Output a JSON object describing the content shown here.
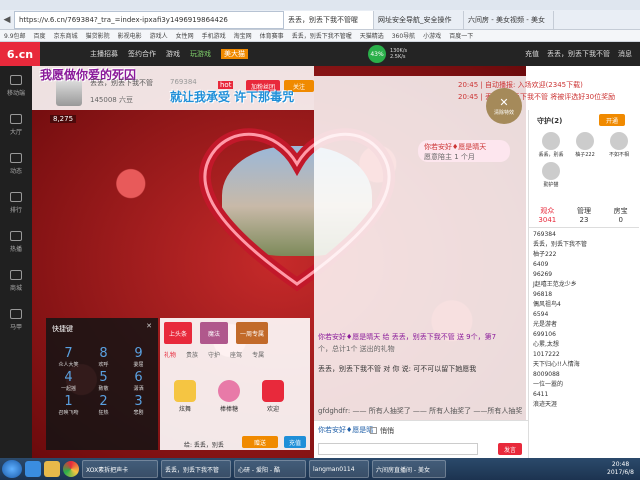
{
  "browser": {
    "url": "https://v.6.cn/769384?_tra_=index-ipxafi3y1496919864426",
    "tabs": [
      {
        "label": "丢丢，别丢下我不管喔",
        "active": true
      },
      {
        "label": "网址安全导航_安全操作"
      },
      {
        "label": "六间房 - 美女视频 - 美女"
      }
    ],
    "bookmarks": [
      "9.9包邮",
      "百度",
      "京东商城",
      "猫贷影院",
      "影视电影",
      "游戏人",
      "女性网",
      "手机游戏",
      "淘宝网",
      "体育赛事",
      "丢丢，别丢下我不管喔",
      "天猫精选",
      "360导航",
      "小游戏",
      "百度一下"
    ]
  },
  "site": {
    "logo": "6.cn",
    "logo_sub": "六间房",
    "nav": [
      "主播招募",
      "签约合作",
      "游戏",
      "玩游戏",
      "美大猫"
    ],
    "speed": "43%",
    "net_up": "130K/s",
    "net_down": "2.5K/s",
    "top_right": [
      "充值",
      "丢丢，别丢下我不管",
      "消息"
    ]
  },
  "left_nav": [
    {
      "label": "移动端"
    },
    {
      "label": "大厅"
    },
    {
      "label": "动态"
    },
    {
      "label": "排行"
    },
    {
      "label": "热播"
    },
    {
      "label": "商城"
    },
    {
      "label": "马甲"
    }
  ],
  "room": {
    "overlay_line1": "我愿做你爱的死囚",
    "overlay_line2": "就让我承受  许下那毒咒",
    "anchor_name": "丢丢，别丢下我不管",
    "anchor_id": "769384",
    "fans": "145008 六豆",
    "follow_btn": "关注",
    "fans_btn": "加粉丝团",
    "hot": "hot",
    "viewers": "8,275",
    "live_badge": "直播",
    "song_banner": "你若安好♦愿是晴天",
    "song_sub": "愿意陪主 1 个月",
    "close_special": "清除特效"
  },
  "chat": {
    "system_lines": [
      "20:45 | 自动播报: 入场欢迎(2345下载)",
      "20:45 | 丢丢，别丢下我不管 将被评选好30位奖励"
    ],
    "messages": [
      "你若安好♦愿是晴天 给 丢丢，别丢下我不管 送 9个，第7",
      "个，总计1个 送出的礼物",
      "丢丢，别丢下我不管 对 你 说: 可不可以留下她愿我",
      "gfdghdfr: —— 所有人抽奖了 —— 所有人抽奖了 ——所有人抽奖"
    ],
    "input_user": "你若安好♦愿是晴",
    "input_placeholder": "",
    "quiet_label": "悄悄",
    "send_btn": "发言"
  },
  "quick_keys": {
    "title": "快捷键",
    "keys": [
      {
        "num": "7",
        "label": "众人大笑"
      },
      {
        "num": "8",
        "label": "欢呼"
      },
      {
        "num": "9",
        "label": "委屈"
      },
      {
        "num": "4",
        "label": "一起摇"
      },
      {
        "num": "5",
        "label": "致敬"
      },
      {
        "num": "6",
        "label": "潇洒"
      },
      {
        "num": "1",
        "label": "召唤飞吻"
      },
      {
        "num": "2",
        "label": "狂热"
      },
      {
        "num": "3",
        "label": "悲剧"
      }
    ]
  },
  "gifts": {
    "tabs": [
      "礼物",
      "贵族",
      "守护",
      "座驾",
      "专属"
    ],
    "items": [
      "炫舞",
      "棒棒糖",
      "欢迎"
    ],
    "badges": [
      "上头条",
      "魔法",
      "一周专属"
    ],
    "to_label": "给: 丢丢，别丢",
    "give_btn": "赠送",
    "recharge_btn": "充值"
  },
  "right_panel": {
    "guard_title": "守护(2)",
    "open_btn": "开通",
    "guards": [
      "丢丢，别丢",
      "柚子222",
      "不如不相",
      "勤护猫"
    ],
    "tabs": [
      {
        "label": "观众",
        "count": "3041"
      },
      {
        "label": "管理",
        "count": "23"
      },
      {
        "label": "房宝",
        "count": "0"
      }
    ],
    "users": [
      "769384",
      "丢丢，别丢下我不管",
      "柚子222",
      "6409",
      "96269",
      "J赵嘻王范龙少乡",
      "96818",
      "偶风祖鸟4",
      "6594",
      "光是游者",
      "699106",
      "心累,太想",
      "1017222",
      "天下归心!!人情海",
      "8009088",
      "一位一嚣的",
      "6411",
      "浪迹天涯"
    ]
  },
  "taskbar": {
    "items": [
      "XOX素拆把声卡",
      "丢丢，别丢下我不管",
      "心研 - 爱阳 - 酷",
      "langman0114",
      "六间房直播间 - 美女"
    ],
    "time": "20:48",
    "date": "2017/6/8"
  },
  "colors": {
    "brand": "#e8293b",
    "dark": "#202020",
    "accent": "#f08a00",
    "link": "#1f5fa8"
  }
}
